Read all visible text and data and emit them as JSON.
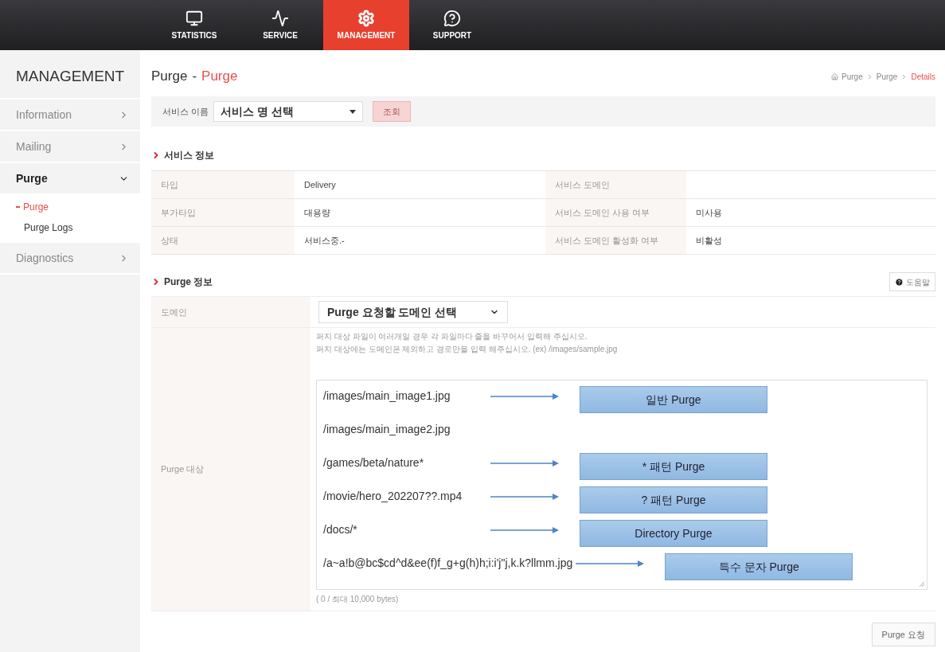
{
  "top_nav": [
    {
      "label": "STATISTICS",
      "selected": false
    },
    {
      "label": "SERVICE",
      "selected": false
    },
    {
      "label": "MANAGEMENT",
      "selected": true
    },
    {
      "label": "SUPPORT",
      "selected": false
    }
  ],
  "sidebar": {
    "title": "MANAGEMENT",
    "items": [
      {
        "label": "Information",
        "selected": false,
        "expanded": false
      },
      {
        "label": "Mailing",
        "selected": false,
        "expanded": false
      },
      {
        "label": "Purge",
        "selected": true,
        "expanded": true,
        "children": [
          {
            "label": "Purge",
            "selected": true
          },
          {
            "label": "Purge Logs",
            "selected": false
          }
        ]
      },
      {
        "label": "Diagnostics",
        "selected": false,
        "expanded": false
      }
    ]
  },
  "page": {
    "title": "Purge",
    "separator": "-",
    "subtitle": "Purge",
    "breadcrumb": [
      "Purge",
      "Purge",
      "Details"
    ]
  },
  "search": {
    "label": "서비스 이름",
    "select": "서비스 명 선택",
    "button": "조회"
  },
  "service_info": {
    "title": "서비스 정보",
    "fields": [
      {
        "label": "타입",
        "value": "Delivery"
      },
      {
        "label": "서비스 도메인"
      },
      {
        "label": "부가타입",
        "value": "대용량"
      },
      {
        "label": "서비스 도메인 사용 여부",
        "value": "미사용"
      },
      {
        "label": "상태",
        "value": "서비스중.-"
      },
      {
        "label": "서비스 도메인 활성화 여부",
        "value": "비활성"
      }
    ]
  },
  "purge_info": {
    "title": "Purge 정보",
    "help_button": "도움말",
    "domain_label": "도메인",
    "domain_select": "Purge 요청할 도메인 선택",
    "target_label": "Purge 대상",
    "hints": [
      "퍼지 대상 파일이 여러개일 경우 각 파일마다 줄을 바꾸어서 입력해 주십시오.",
      "퍼지 대상에는 도메인은 제외하고 경로만을 입력 해주십시오. (ex) /images/sample.jpg"
    ],
    "lines": [
      {
        "path": "/images/main_image1.jpg",
        "tag": "일반 Purge"
      },
      {
        "path": "/images/main_image2.jpg"
      },
      {
        "path": "/games/beta/nature*",
        "tag": "* 패턴 Purge"
      },
      {
        "path": "/movie/hero_202207??.mp4",
        "tag": "? 패턴 Purge"
      },
      {
        "path": "/docs/*",
        "tag": "Directory Purge"
      },
      {
        "path": "/a~a!b@bc$cd^d&ee(f)f_g+g(h)h;i:i'j\"j,k.k?llmm.jpg",
        "tag": "특수 문자 Purge"
      }
    ],
    "byte_count": "( 0 / 최대 10,000 bytes)",
    "submit": "Purge 요청"
  }
}
